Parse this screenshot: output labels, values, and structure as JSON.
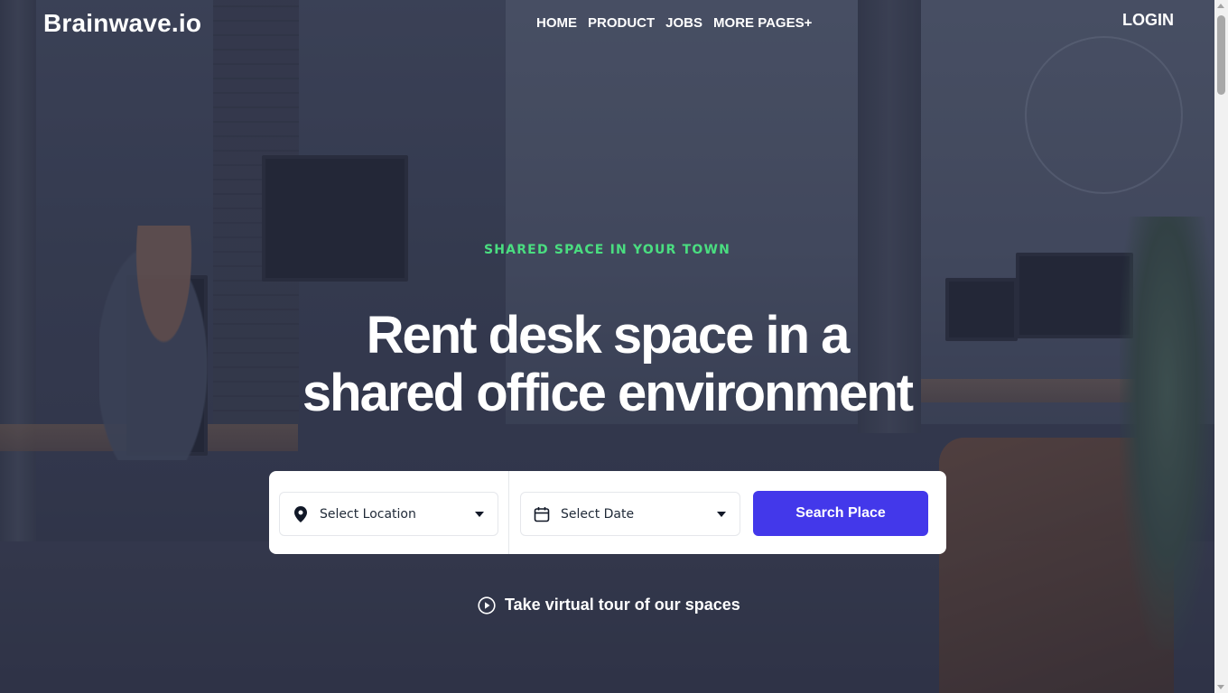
{
  "header": {
    "logo_text": "Brainwave.io",
    "nav": [
      {
        "label": "HOME"
      },
      {
        "label": "PRODUCT"
      },
      {
        "label": "JOBS"
      },
      {
        "label": "MORE PAGES+"
      }
    ],
    "login_label": "LOGIN"
  },
  "hero": {
    "eyebrow": "SHARED SPACE IN YOUR TOWN",
    "headline_line1": "Rent desk space in a",
    "headline_line2": "shared office environment",
    "tour_label": "Take virtual tour of our spaces"
  },
  "search": {
    "location_value": "Select Location",
    "location_icon": "map-pin-icon",
    "date_value": "Select Date",
    "date_icon": "calendar-icon",
    "button_label": "Search Place"
  },
  "colors": {
    "accent": "#4338ea",
    "eyebrow": "#4ade80",
    "text_on_dark": "#ffffff"
  }
}
